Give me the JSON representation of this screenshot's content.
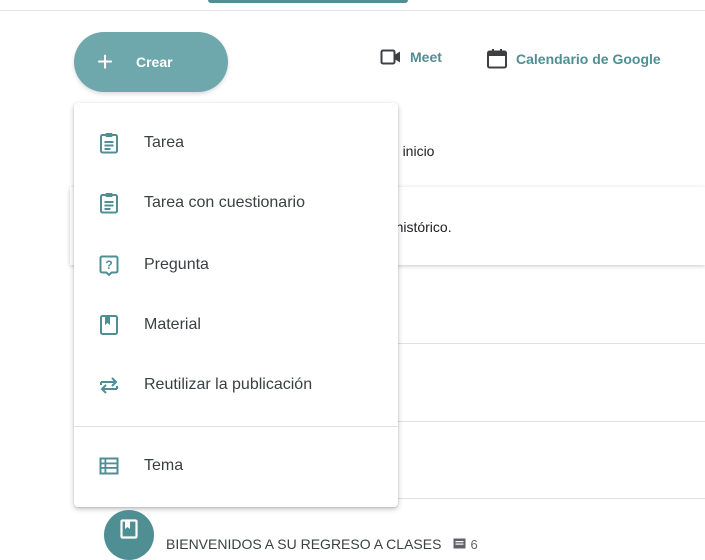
{
  "toolbar": {
    "create_label": "Crear",
    "meet_label": "Meet",
    "calendar_label": "Calendario de Google"
  },
  "stream": {
    "card1_text": ". el inicio",
    "card2_text": "to histórico."
  },
  "menu": {
    "items": [
      {
        "label": "Tarea",
        "icon": "assignment-icon"
      },
      {
        "label": "Tarea con cuestionario",
        "icon": "quiz-assignment-icon"
      },
      {
        "label": "Pregunta",
        "icon": "question-icon"
      },
      {
        "label": "Material",
        "icon": "material-icon"
      },
      {
        "label": "Reutilizar la publicación",
        "icon": "reuse-icon"
      },
      {
        "label": "Tema",
        "icon": "topic-icon"
      }
    ]
  },
  "topic": {
    "title": "BIENVENIDOS A SU REGRESO A CLASES",
    "count": "6"
  },
  "colors": {
    "accent": "#4f8f94",
    "create_button": "#6ea8ad"
  }
}
